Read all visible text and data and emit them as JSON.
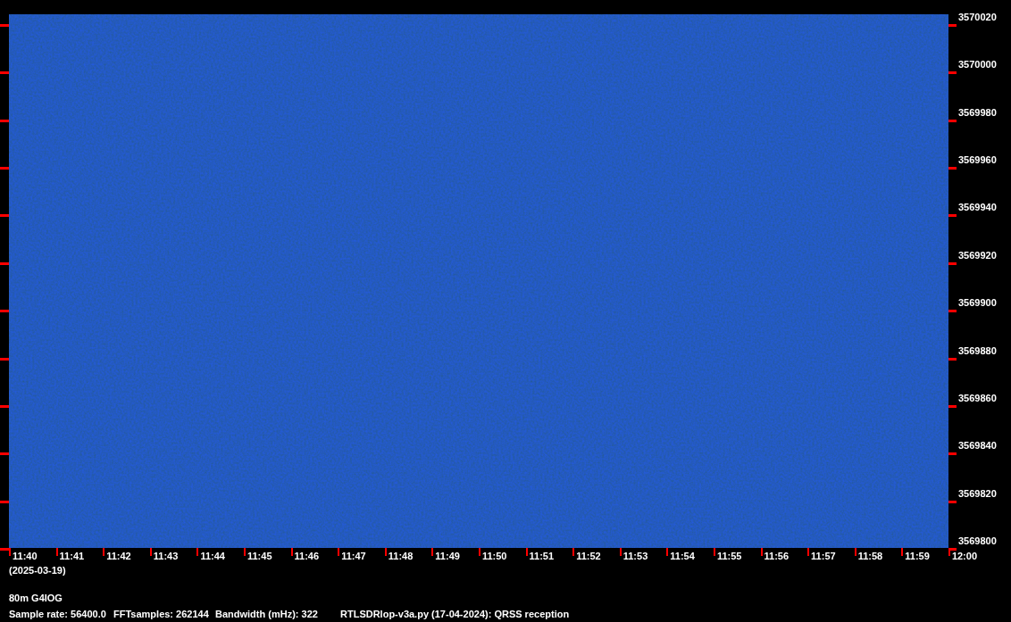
{
  "frequency_axis": {
    "labels": [
      "3570020",
      "3570000",
      "3569980",
      "3569960",
      "3569940",
      "3569920",
      "3569900",
      "3569880",
      "3569860",
      "3569840",
      "3569820",
      "3569800"
    ]
  },
  "time_axis": {
    "labels": [
      "11:40",
      "11:41",
      "11:42",
      "11:43",
      "11:44",
      "11:45",
      "11:46",
      "11:47",
      "11:48",
      "11:49",
      "11:50",
      "11:51",
      "11:52",
      "11:53",
      "11:54",
      "11:55",
      "11:56",
      "11:57",
      "11:58",
      "11:59",
      "12:00"
    ],
    "date": "(2025-03-19)"
  },
  "station": "80m G4IOG",
  "info": [
    "Sample rate: 56400.0",
    "FFTsamples: 262144",
    "Bandwidth (mHz): 322",
    "RTLSDRlop-v3a.py (17-04-2024): QRSS reception"
  ]
}
